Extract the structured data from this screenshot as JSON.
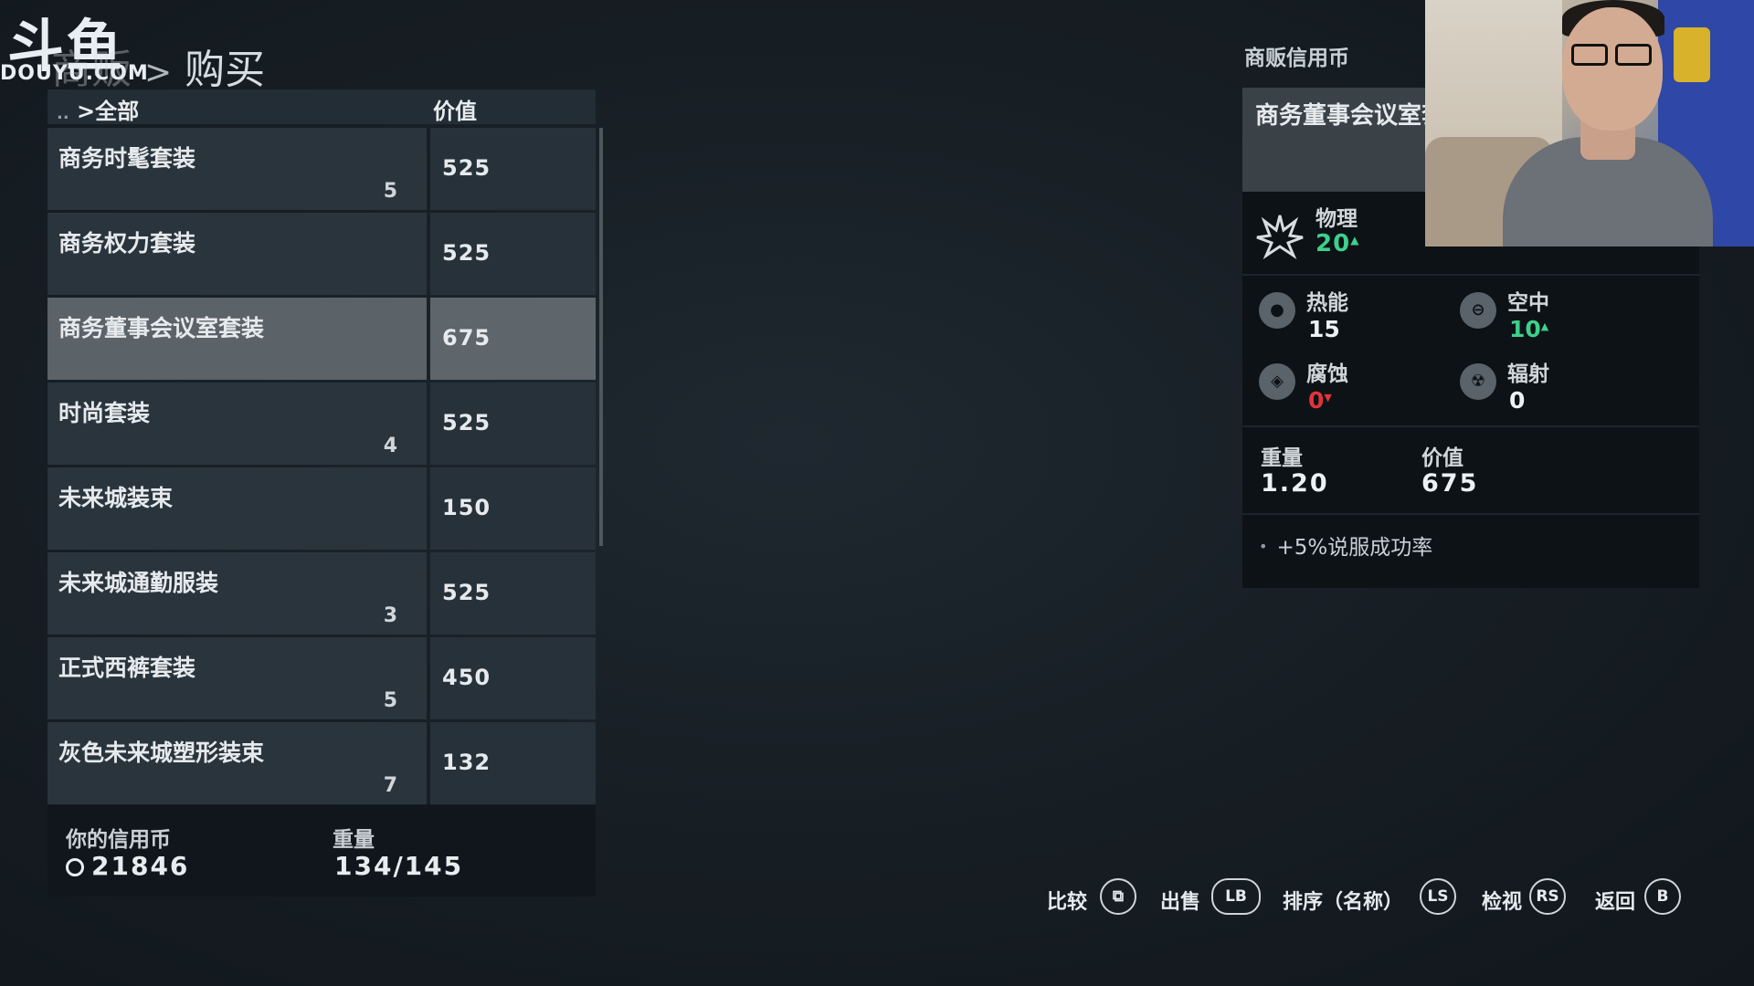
{
  "watermark": {
    "logo_cn": "斗鱼",
    "logo_en": "DOUYU.COM"
  },
  "breadcrumb": {
    "parent": "商贩",
    "separator": ">",
    "current": "购买"
  },
  "list": {
    "filter_prefix": "..",
    "filter_sep": ">",
    "filter_label": "全部",
    "value_header": "价值",
    "items": [
      {
        "name": "商务时髦套装",
        "qty": "5",
        "value": "525",
        "selected": false
      },
      {
        "name": "商务权力套装",
        "qty": "",
        "value": "525",
        "selected": false
      },
      {
        "name": "商务董事会议室套装",
        "qty": "",
        "value": "675",
        "selected": true
      },
      {
        "name": "时尚套装",
        "qty": "4",
        "value": "525",
        "selected": false
      },
      {
        "name": "未来城装束",
        "qty": "",
        "value": "150",
        "selected": false
      },
      {
        "name": "未来城通勤服装",
        "qty": "3",
        "value": "525",
        "selected": false
      },
      {
        "name": "正式西裤套装",
        "qty": "5",
        "value": "450",
        "selected": false
      },
      {
        "name": "灰色未来城塑形装束",
        "qty": "7",
        "value": "132",
        "selected": false
      }
    ]
  },
  "footer": {
    "credits_label": "你的信用币",
    "credits_value": "21846",
    "weight_label": "重量",
    "weight_value": "134/145"
  },
  "detail": {
    "vendor_credits_label": "商贩信用币",
    "title": "商务董事会议室套装",
    "physical_label": "物理",
    "physical_value": "20",
    "resistances": {
      "thermal_label": "热能",
      "thermal_value": "15",
      "airborne_label": "空中",
      "airborne_value": "10",
      "corrosive_label": "腐蚀",
      "corrosive_value": "0",
      "radiation_label": "辐射",
      "radiation_value": "0"
    },
    "weight_label": "重量",
    "weight_value": "1.20",
    "value_label": "价值",
    "value_value": "675",
    "perk": "+5%说服成功率"
  },
  "buttons": {
    "compare_label": "比较",
    "sell_label": "出售",
    "sell_key": "LB",
    "sort_label": "排序（名称）",
    "sort_key": "LS",
    "inspect_label": "检视",
    "inspect_key": "RS",
    "back_label": "返回",
    "back_key": "B"
  },
  "colors": {
    "positive": "#3ed08c",
    "negative": "#e0343a",
    "selected_row": "#5c6368"
  }
}
